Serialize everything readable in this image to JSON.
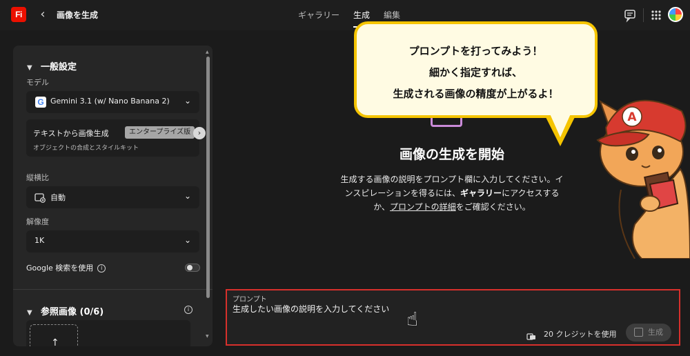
{
  "app": {
    "logo_text": "Fi",
    "title": "画像を生成",
    "back_glyph": "‹"
  },
  "tabs": [
    {
      "label": "ギャラリー",
      "active": false
    },
    {
      "label": "生成",
      "active": true
    },
    {
      "label": "編集",
      "active": false
    }
  ],
  "header_icons": [
    "chat-icon",
    "apps-grid-icon",
    "user-avatar"
  ],
  "sidebar": {
    "general_section": "一般設定",
    "model_label": "モデル",
    "model_value": "Gemini 3.1 (w/ Nano Banana 2)",
    "text_to_image": {
      "title": "テキストから画像生成",
      "badge": "エンタープライズ版",
      "subtitle": "オブジェクトの合成とスタイルキット"
    },
    "aspect_label": "縦横比",
    "aspect_value": "自動",
    "resolution_label": "解像度",
    "resolution_value": "1K",
    "google_search_label": "Google 検索を使用",
    "google_search_enabled": false,
    "reference_section": "参照画像 (0/6)"
  },
  "callout": {
    "line1": "プロンプトを打ってみよう！",
    "line2": "細かく指定すれば、",
    "line3": "生成される画像の精度が上がるよ！",
    "border_color": "#f5c400",
    "fill_color": "#fffbe3"
  },
  "main": {
    "title": "画像の生成を開始",
    "desc_part1": "生成する画像の説明をプロンプト欄に入力してください。インスピレーションを得るには、",
    "desc_gallery": "ギャラリー",
    "desc_part2": "にアクセスするか、",
    "desc_link": "プロンプトの詳細",
    "desc_part3": "をご確認ください。"
  },
  "prompt": {
    "label": "プロンプト",
    "placeholder": "生成したい画像の説明を入力してください",
    "credits": "20 クレジットを使用",
    "generate_label": "生成",
    "highlight_color": "#d8302c"
  },
  "mascot": {
    "cap_letter": "A"
  }
}
